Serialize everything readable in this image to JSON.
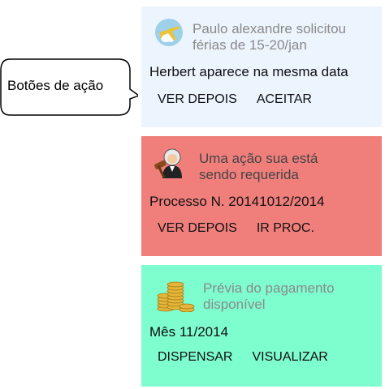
{
  "callout": {
    "label": "Botões de ação"
  },
  "notifications": [
    {
      "icon": "airplane-sun-icon",
      "title_line1": "Paulo alexandre solicitou",
      "title_line2": "férias de 15-20/jan",
      "subtitle": "Herbert aparece na mesma data",
      "actions": [
        "VER DEPOIS",
        "ACEITAR"
      ],
      "background": "#ecf4fd"
    },
    {
      "icon": "judge-gavel-icon",
      "title_line1": "Uma ação sua está",
      "title_line2": "sendo requerida",
      "subtitle": "Processo N. 20141012/2014",
      "actions": [
        "VER DEPOIS",
        "IR PROC."
      ],
      "background": "#f07f7c"
    },
    {
      "icon": "gold-coins-icon",
      "title_line1": "Prévia do pagamento",
      "title_line2": "disponível",
      "subtitle": "Mês 11/2014",
      "actions": [
        "DISPENSAR",
        "VISUALIZAR"
      ],
      "background": "#7efdcf"
    }
  ]
}
